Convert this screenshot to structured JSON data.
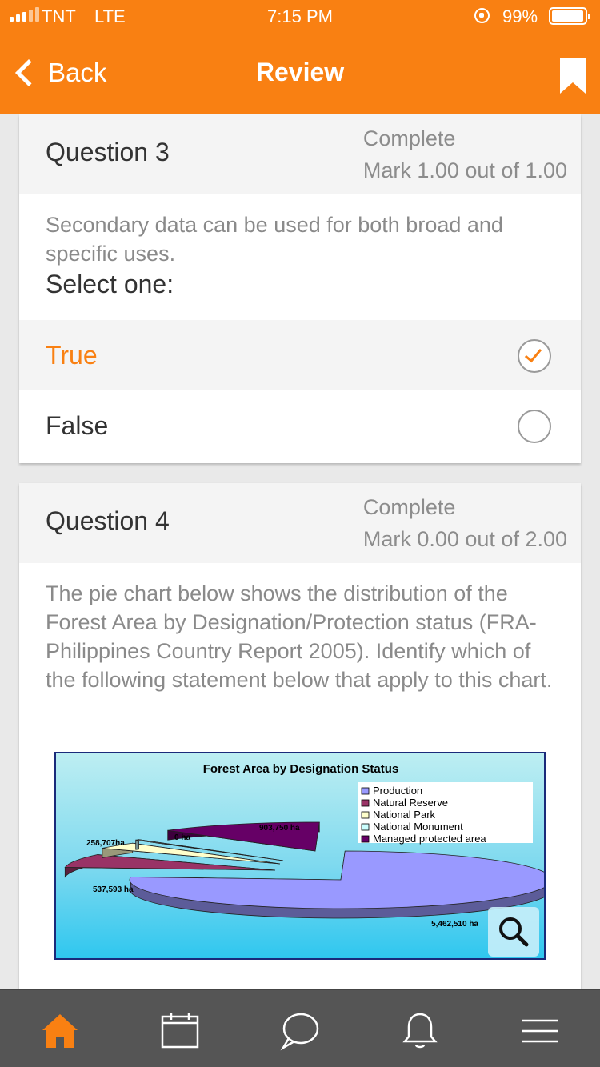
{
  "status_bar": {
    "carrier": "TNT",
    "network": "LTE",
    "time": "7:15 PM",
    "battery": "99%"
  },
  "nav": {
    "back_label": "Back",
    "title": "Review"
  },
  "question3": {
    "number": "Question 3",
    "state": "Complete",
    "mark": "Mark 1.00 out of 1.00",
    "text": "Secondary data can be used for both broad and specific uses.",
    "prompt": "Select one:",
    "options": [
      {
        "label": "True",
        "selected": true
      },
      {
        "label": "False",
        "selected": false
      }
    ]
  },
  "question4": {
    "number": "Question 4",
    "state": "Complete",
    "mark": "Mark 0.00 out of 2.00",
    "text": "The pie chart below shows the distribution of the Forest Area by Designation/Protection status (FRA-Philippines Country Report 2005). Identify which of the following statement below that apply to this chart."
  },
  "chart_data": {
    "type": "pie",
    "title": "Forest Area by Designation Status",
    "categories": [
      "Production",
      "Natural Reserve",
      "National Park",
      "National Monument",
      "Managed protected area"
    ],
    "values": [
      5462510,
      537593,
      258707,
      0,
      903750
    ],
    "data_labels": [
      "5,462,510 ha",
      "537,593 ha",
      "258,707ha",
      "0 ha",
      "903,750 ha"
    ],
    "colors": [
      "#9999ff",
      "#993366",
      "#ffffcc",
      "#ccffff",
      "#660066"
    ],
    "legend_position": "top-right"
  },
  "tabs": [
    "home",
    "calendar",
    "messages",
    "notifications",
    "menu"
  ],
  "colors": {
    "accent": "#f98012",
    "tabbar": "#555555"
  }
}
